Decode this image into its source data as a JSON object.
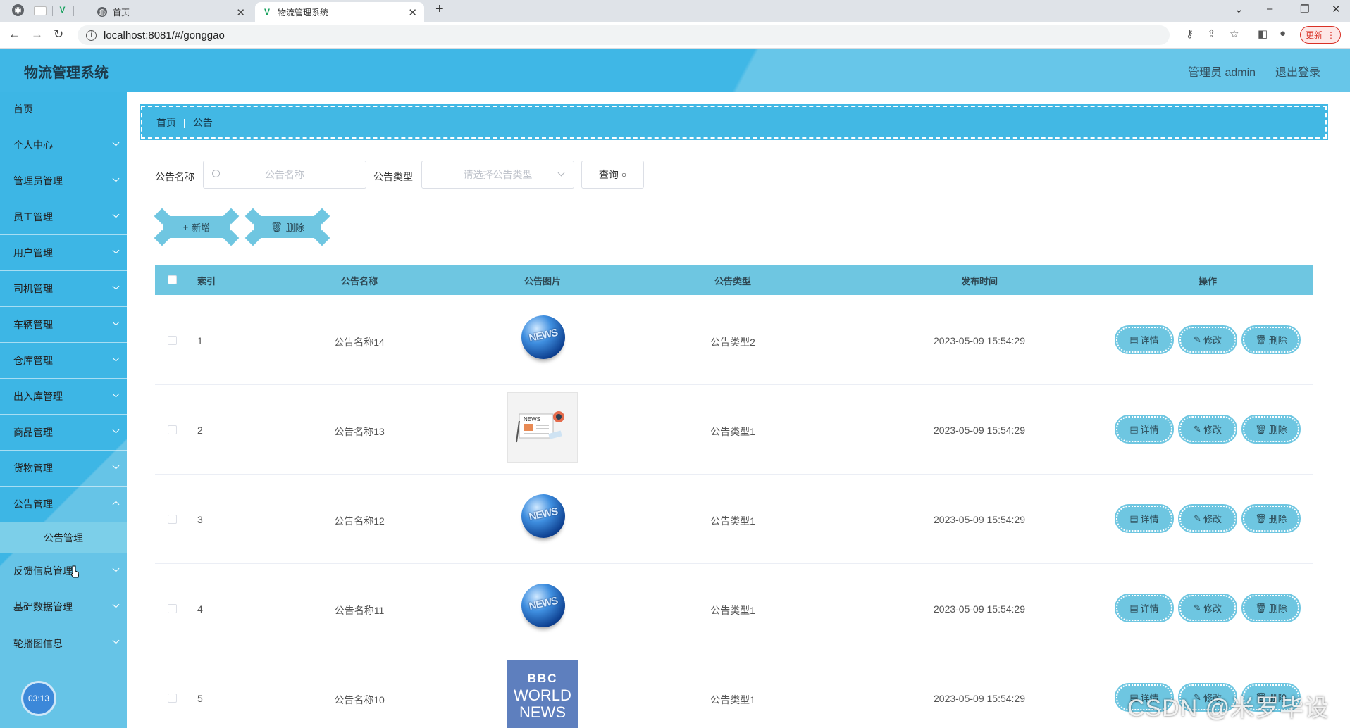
{
  "browser": {
    "tabs": [
      {
        "label": "首页"
      },
      {
        "label": "物流管理系统"
      }
    ],
    "url": "localhost:8081/#/gonggao",
    "update_label": "更新"
  },
  "app": {
    "title": "物流管理系统",
    "user_label": "管理员 admin",
    "logout_label": "退出登录"
  },
  "sidebar": {
    "items": [
      {
        "label": "首页"
      },
      {
        "label": "个人中心"
      },
      {
        "label": "管理员管理"
      },
      {
        "label": "员工管理"
      },
      {
        "label": "用户管理"
      },
      {
        "label": "司机管理"
      },
      {
        "label": "车辆管理"
      },
      {
        "label": "仓库管理"
      },
      {
        "label": "出入库管理"
      },
      {
        "label": "商品管理"
      },
      {
        "label": "货物管理"
      },
      {
        "label": "公告管理"
      },
      {
        "label": "公告管理"
      },
      {
        "label": "反馈信息管理"
      },
      {
        "label": "基础数据管理"
      },
      {
        "label": "轮播图信息"
      }
    ],
    "clock": "03:13"
  },
  "breadcrumb": {
    "home": "首页",
    "current": "公告"
  },
  "filters": {
    "name_label": "公告名称",
    "name_placeholder": "公告名称",
    "type_label": "公告类型",
    "type_placeholder": "请选择公告类型",
    "query_label": "查询"
  },
  "actions": {
    "add_label": "新增",
    "delete_label": "删除"
  },
  "table": {
    "headers": {
      "index": "索引",
      "name": "公告名称",
      "image": "公告图片",
      "type": "公告类型",
      "time": "发布时间",
      "ops": "操作"
    },
    "rows": [
      {
        "index": "1",
        "name": "公告名称14",
        "image": "news-globe",
        "type": "公告类型2",
        "time": "2023-05-09 15:54:29"
      },
      {
        "index": "2",
        "name": "公告名称13",
        "image": "news-paper",
        "type": "公告类型1",
        "time": "2023-05-09 15:54:29"
      },
      {
        "index": "3",
        "name": "公告名称12",
        "image": "news-globe",
        "type": "公告类型1",
        "time": "2023-05-09 15:54:29"
      },
      {
        "index": "4",
        "name": "公告名称11",
        "image": "news-globe",
        "type": "公告类型1",
        "time": "2023-05-09 15:54:29"
      },
      {
        "index": "5",
        "name": "公告名称10",
        "image": "bbc-world-news",
        "type": "公告类型1",
        "time": "2023-05-09 15:54:29"
      }
    ],
    "op_labels": {
      "detail": "详情",
      "edit": "修改",
      "delete": "删除"
    }
  },
  "thumb_text": {
    "globe": "NEWS",
    "paper": "NEWS",
    "bbc1": "BBC",
    "bbc2": "WORLD",
    "bbc3": "NEWS"
  },
  "watermark": "CSDN @米罗毕设",
  "colors": {
    "topbar": "#3fb7e6",
    "sidebar": "#3db6e5",
    "accent": "#6ec6e1"
  }
}
